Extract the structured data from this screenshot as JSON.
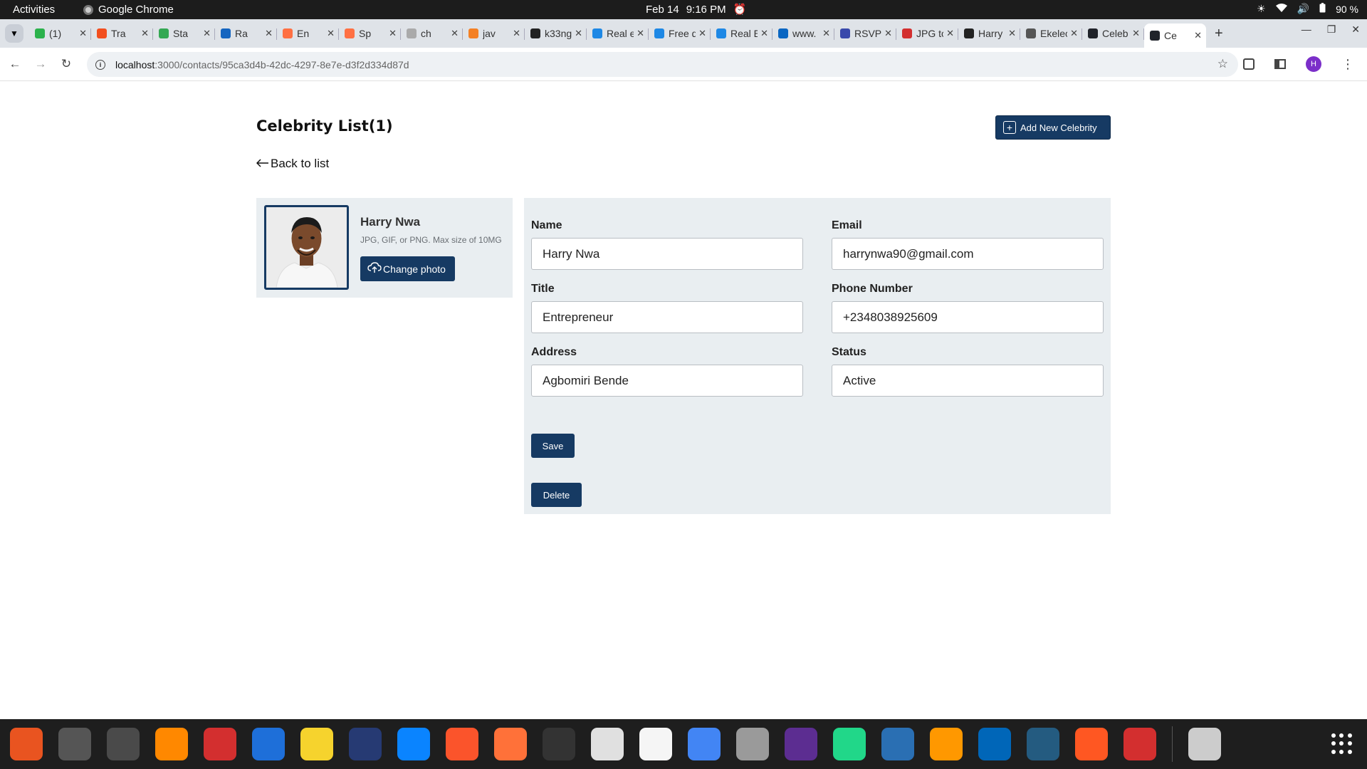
{
  "system_bar": {
    "activities": "Activities",
    "app_name": "Google Chrome",
    "date": "Feb 14",
    "time": "9:16 PM",
    "battery": "90 %"
  },
  "tabs": [
    {
      "title": "(1)",
      "color": "#2bb24c"
    },
    {
      "title": "Tra",
      "color": "#f24e1e"
    },
    {
      "title": "Sta",
      "color": "#34a853"
    },
    {
      "title": "Ra",
      "color": "#1565c0"
    },
    {
      "title": "En",
      "color": "#ff7043"
    },
    {
      "title": "Sp",
      "color": "#ff7043"
    },
    {
      "title": "ch",
      "color": "#aaaaaa"
    },
    {
      "title": "jav",
      "color": "#f48024"
    },
    {
      "title": "k33ng",
      "color": "#222222"
    },
    {
      "title": "Real e",
      "color": "#1e88e5"
    },
    {
      "title": "Free d",
      "color": "#1e88e5"
    },
    {
      "title": "Real E",
      "color": "#1e88e5"
    },
    {
      "title": "www.",
      "color": "#0a66c2"
    },
    {
      "title": "RSVP",
      "color": "#3949ab"
    },
    {
      "title": "JPG to",
      "color": "#d32f2f"
    },
    {
      "title": "Harry",
      "color": "#222222"
    },
    {
      "title": "Ekelec",
      "color": "#555555"
    },
    {
      "title": "Celeb",
      "color": "#20232a"
    },
    {
      "title": "Ce",
      "color": "#20232a",
      "active": true
    }
  ],
  "address_bar": {
    "host": "localhost",
    "path": ":3000/contacts/95ca3d4b-42dc-4297-8e7e-d3f2d334d87d",
    "avatar_letter": "H"
  },
  "page": {
    "title": "Celebrity List(1)",
    "add_button": "Add New Celebrity",
    "back_link": "Back to list",
    "profile": {
      "name": "Harry Nwa",
      "hint": "JPG, GIF, or PNG. Max size of 10MG",
      "change_photo": "Change photo"
    },
    "form": {
      "name_label": "Name",
      "name_value": "Harry Nwa",
      "email_label": "Email",
      "email_value": "harrynwa90@gmail.com",
      "title_label": "Title",
      "title_value": "Entrepreneur",
      "phone_label": "Phone Number",
      "phone_value": "+2348038925609",
      "address_label": "Address",
      "address_value": "Agbomiri Bende",
      "status_label": "Status",
      "status_value": "Active",
      "save": "Save",
      "delete": "Delete"
    }
  },
  "dock": [
    {
      "name": "app-center-icon",
      "color": "#e95420"
    },
    {
      "name": "settings-icon",
      "color": "#555555"
    },
    {
      "name": "calculator-icon",
      "color": "#4a4a4a"
    },
    {
      "name": "vlc-icon",
      "color": "#ff8800"
    },
    {
      "name": "wps-icon",
      "color": "#d32f2f"
    },
    {
      "name": "document-icon",
      "color": "#1e6fd9"
    },
    {
      "name": "rhythmbox-icon",
      "color": "#f6d32d"
    },
    {
      "name": "mail-icon",
      "color": "#263a73"
    },
    {
      "name": "thunderbird-icon",
      "color": "#0a84ff"
    },
    {
      "name": "brave-icon",
      "color": "#fb542b"
    },
    {
      "name": "firefox-icon",
      "color": "#ff7139"
    },
    {
      "name": "terminal-icon",
      "color": "#333333"
    },
    {
      "name": "viewer-icon",
      "color": "#e0e0e0"
    },
    {
      "name": "text-editor-icon",
      "color": "#f5f5f5"
    },
    {
      "name": "chrome-icon",
      "color": "#4285f4"
    },
    {
      "name": "files-icon",
      "color": "#9a9a9a"
    },
    {
      "name": "intellij-icon",
      "color": "#5c2d91"
    },
    {
      "name": "pycharm-icon",
      "color": "#21d789"
    },
    {
      "name": "dictionary-icon",
      "color": "#2a6fb3"
    },
    {
      "name": "draw-icon",
      "color": "#ff9800"
    },
    {
      "name": "vscode-icon",
      "color": "#0066b8"
    },
    {
      "name": "mysql-workbench-icon",
      "color": "#245b80"
    },
    {
      "name": "sketch-icon",
      "color": "#ff5722"
    },
    {
      "name": "download-icon",
      "color": "#d32f2f"
    },
    {
      "name": "trash-icon",
      "color": "#cccccc"
    }
  ]
}
